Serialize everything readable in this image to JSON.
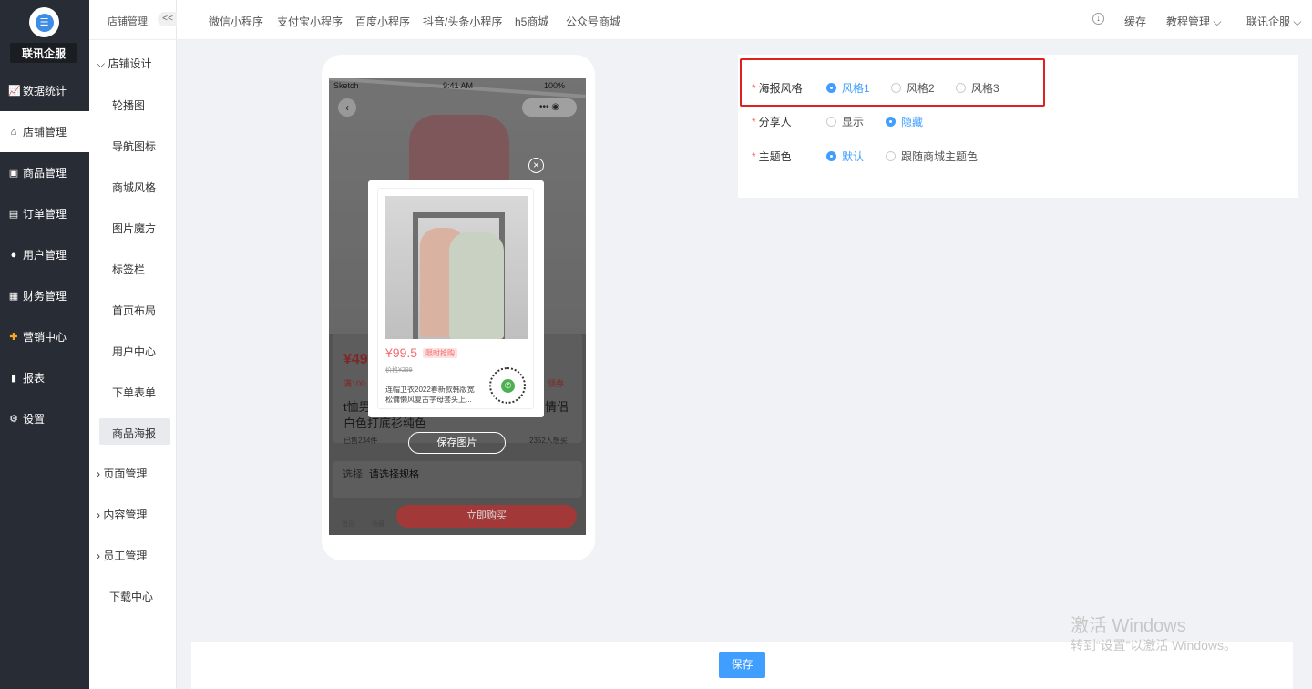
{
  "brand": "联讯企服",
  "sidebar": {
    "items": [
      {
        "label": "数据统计",
        "icon": "chart-icon"
      },
      {
        "label": "店铺管理",
        "icon": "shop-icon"
      },
      {
        "label": "商品管理",
        "icon": "goods-icon"
      },
      {
        "label": "订单管理",
        "icon": "order-icon"
      },
      {
        "label": "用户管理",
        "icon": "user-icon"
      },
      {
        "label": "财务管理",
        "icon": "finance-icon"
      },
      {
        "label": "营销中心",
        "icon": "marketing-icon"
      },
      {
        "label": "报表",
        "icon": "report-icon"
      },
      {
        "label": "设置",
        "icon": "settings-icon"
      }
    ]
  },
  "subnav": {
    "title": "店铺管理",
    "collapse": "<<",
    "group1": "店铺设计",
    "items": [
      "轮播图",
      "导航图标",
      "商城风格",
      "图片魔方",
      "标签栏",
      "首页布局",
      "用户中心",
      "下单表单",
      "商品海报"
    ],
    "group2": "页面管理",
    "group3": "内容管理",
    "group4": "员工管理",
    "download": "下载中心"
  },
  "topbar": {
    "tabs": [
      "微信小程序",
      "支付宝小程序",
      "百度小程序",
      "抖音/头条小程序",
      "h5商城",
      "公众号商城"
    ],
    "cache": "缓存",
    "tutorial": "教程管理",
    "account": "联讯企服"
  },
  "preview": {
    "status_carrier": "Sketch",
    "status_time": "9:41 AM",
    "status_battery": "100%",
    "price_bg": "¥49",
    "promo": "满100",
    "coupon": "领券",
    "title_l": "t恤男",
    "title_r": "情侣",
    "title2": "白色打底衫纯色",
    "sold": "已售234件",
    "views": "2352人想买",
    "spec_label": "选择",
    "spec_value": "请选择规格",
    "home": "首页",
    "fav": "收藏",
    "buy": "立即购买",
    "poster_price": "¥99.5",
    "poster_tag": "限时抢购",
    "poster_orig": "价格¥299",
    "poster_desc1": "连帽卫衣2022春新款韩版宽",
    "poster_desc2": "松慵懒风复古字母套头上...",
    "save_image": "保存图片"
  },
  "config": {
    "poster_style": {
      "label": "海报风格",
      "options": [
        "风格1",
        "风格2",
        "风格3"
      ],
      "selected": 0
    },
    "sharer": {
      "label": "分享人",
      "options": [
        "显示",
        "隐藏"
      ],
      "selected": 1
    },
    "theme": {
      "label": "主题色",
      "options": [
        "默认",
        "跟随商城主题色"
      ],
      "selected": 0
    }
  },
  "footer": {
    "save": "保存"
  },
  "watermark": {
    "line1": "激活 Windows",
    "line2": "转到“设置”以激活 Windows。"
  },
  "colors": {
    "accent": "#409eff",
    "sidebar": "#282c34",
    "highlight": "#e02020",
    "price": "#f56c6c"
  }
}
